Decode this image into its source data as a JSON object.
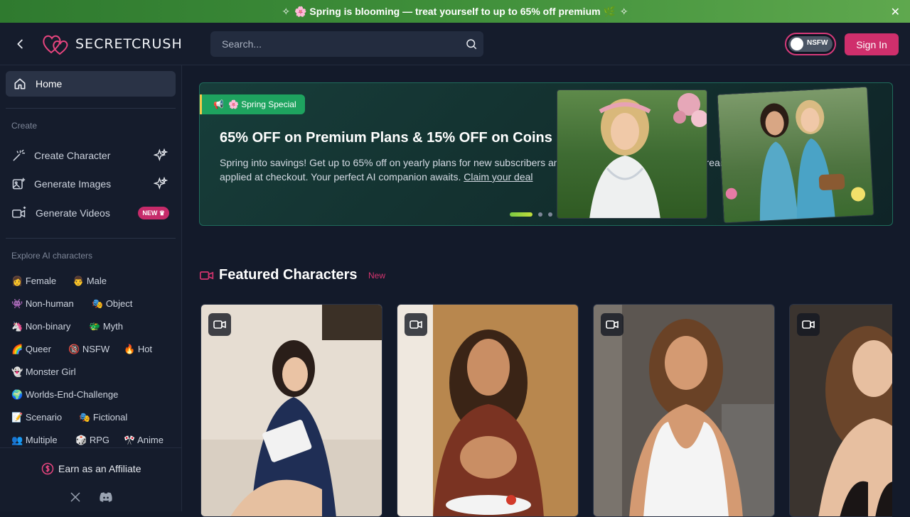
{
  "promo": {
    "text": "🌸 Spring is blooming — treat yourself to up to 65% off premium 🌿",
    "close": "✕"
  },
  "header": {
    "logo": "SECRETCRUSH",
    "search_placeholder": "Search...",
    "nsfw_label": "NSFW",
    "signin_label": "Sign In"
  },
  "sidebar": {
    "home": "Home",
    "create_label": "Create",
    "create_items": [
      {
        "label": "Create Character"
      },
      {
        "label": "Generate Images"
      },
      {
        "label": "Generate Videos",
        "badge": "NEW"
      }
    ],
    "explore_label": "Explore AI characters",
    "tags": [
      {
        "emoji": "👩",
        "label": "Female"
      },
      {
        "emoji": "👨",
        "label": "Male"
      },
      {
        "emoji": "👾",
        "label": "Non-human"
      },
      {
        "emoji": "🎭",
        "label": "Object"
      },
      {
        "emoji": "🦄",
        "label": "Non-binary"
      },
      {
        "emoji": "🐲",
        "label": "Myth"
      },
      {
        "emoji": "🌈",
        "label": "Queer"
      },
      {
        "emoji": "🔞",
        "label": "NSFW"
      },
      {
        "emoji": "🔥",
        "label": "Hot"
      },
      {
        "emoji": "👻",
        "label": "Monster Girl"
      },
      {
        "emoji": "🌍",
        "label": "Worlds-End-Challenge"
      },
      {
        "emoji": "📝",
        "label": "Scenario"
      },
      {
        "emoji": "🎭",
        "label": "Fictional"
      },
      {
        "emoji": "👥",
        "label": "Multiple"
      },
      {
        "emoji": "🎲",
        "label": "RPG"
      },
      {
        "emoji": "🎌",
        "label": "Anime"
      }
    ],
    "affiliate": "Earn as an Affiliate"
  },
  "hero": {
    "badge": "🌸 Spring Special",
    "title": "65% OFF on Premium Plans & 15% OFF on Coins",
    "desc_1": "Spring into savings! Get up to 65% off on yearly plans for new subscribers and 15% off coin packs. Discount",
    "desc_2": "already applied at checkout. Your perfect AI companion awaits.",
    "link": "Claim your deal"
  },
  "featured": {
    "title": "Featured Characters",
    "new_label": "New"
  },
  "colors": {
    "accent": "#cf2f6c",
    "brand_pink": "#e8457f",
    "promo_green": "#3f8f3a",
    "hero_badge": "#1ea35f"
  }
}
